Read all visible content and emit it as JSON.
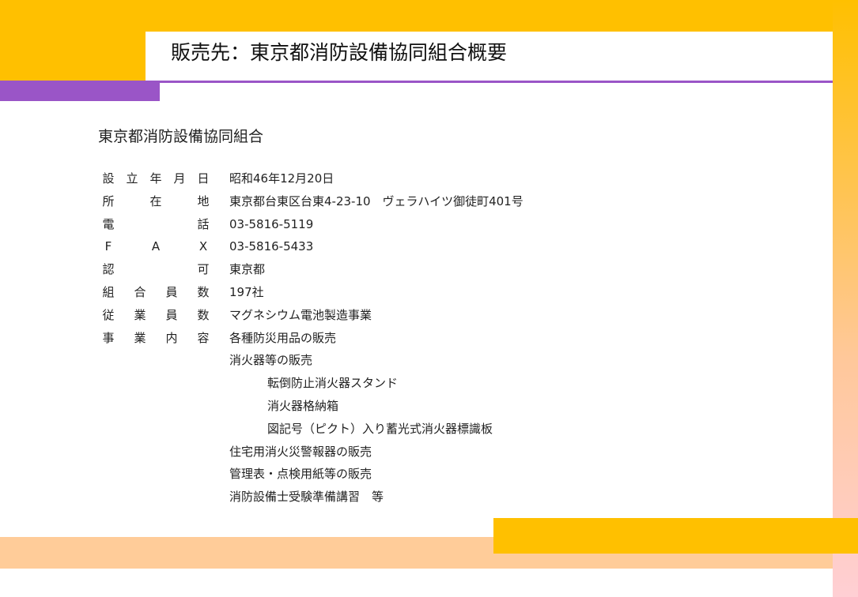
{
  "page": {
    "title": "販売先：東京都消防設備協同組合概要"
  },
  "org": {
    "name": "東京都消防設備協同組合",
    "rows": [
      {
        "label": [
          "設",
          "立",
          "年",
          "月",
          "日"
        ],
        "value": "昭和46年12月20日"
      },
      {
        "label": [
          "所",
          "在",
          "地"
        ],
        "value": "東京都台東区台東4-23-10　ヴェラハイツ御徒町401号"
      },
      {
        "label": [
          "電",
          "話"
        ],
        "value": "03-5816-5119"
      },
      {
        "label": [
          "F",
          "A",
          "X"
        ],
        "value": "03-5816-5433"
      },
      {
        "label": [
          "認",
          "可"
        ],
        "value": "東京都"
      },
      {
        "label": [
          "組",
          "合",
          "員",
          "数"
        ],
        "value": "197社"
      },
      {
        "label": [
          "従",
          "業",
          "員",
          "数"
        ],
        "value": "マグネシウム電池製造事業"
      },
      {
        "label": [
          "事",
          "業",
          "内",
          "容"
        ],
        "value": "各種防災用品の販売"
      }
    ],
    "business": [
      {
        "text": "消火器等の販売",
        "level": 0
      },
      {
        "text": "転倒防止消火器スタンド",
        "level": 1
      },
      {
        "text": "消火器格納箱",
        "level": 1
      },
      {
        "text": "図記号（ピクト）入り蓄光式消火器標識板",
        "level": 1
      },
      {
        "text": "住宅用消火災警報器の販売",
        "level": 0
      },
      {
        "text": "管理表・点検用紙等の販売",
        "level": 0
      },
      {
        "text": "消防設備士受験準備講習　等",
        "level": 0
      }
    ]
  }
}
